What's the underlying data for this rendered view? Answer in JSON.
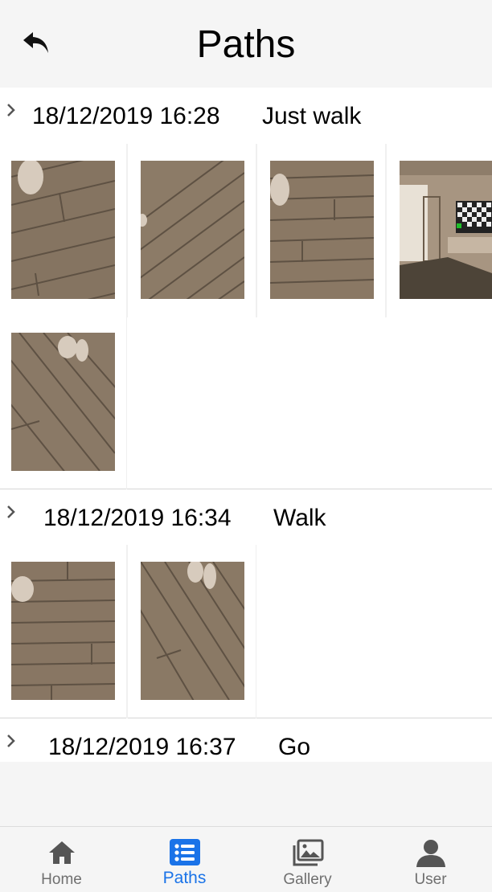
{
  "header": {
    "title": "Paths"
  },
  "paths": [
    {
      "date": "18/12/2019 16:28",
      "name": "Just walk"
    },
    {
      "date": "18/12/2019 16:34",
      "name": "Walk"
    },
    {
      "date": "18/12/2019 16:37",
      "name": "Go"
    }
  ],
  "tabs": [
    {
      "label": "Home",
      "icon": "home-icon"
    },
    {
      "label": "Paths",
      "icon": "list-icon"
    },
    {
      "label": "Gallery",
      "icon": "gallery-icon"
    },
    {
      "label": "User",
      "icon": "user-icon"
    }
  ],
  "colors": {
    "accent": "#1a73e8",
    "tab_inactive": "#6f6f6f",
    "icon_inactive": "#555555"
  }
}
